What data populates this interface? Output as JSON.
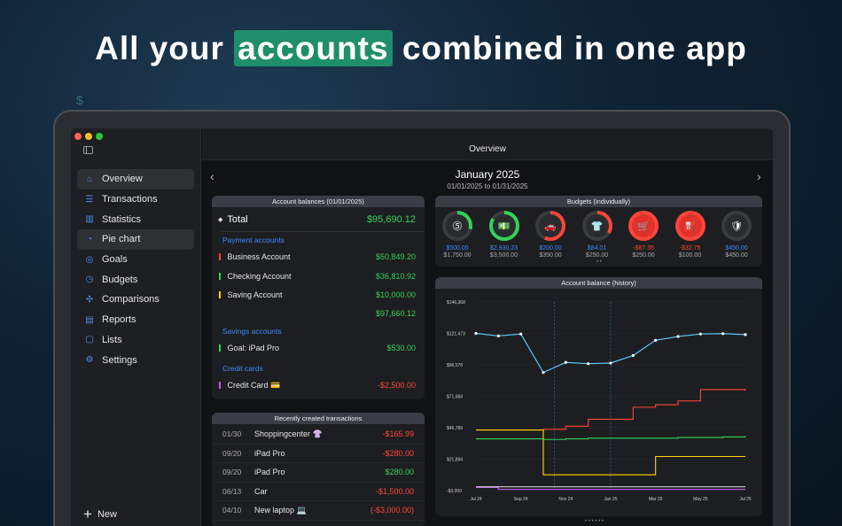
{
  "headline": {
    "pre": "All your",
    "highlight": "accounts",
    "post": "combined in one app"
  },
  "deco": "$",
  "window": {
    "title": "Overview"
  },
  "sidebar": {
    "items": [
      {
        "label": "Overview",
        "icon": "home-icon",
        "glyph": "⌂"
      },
      {
        "label": "Transactions",
        "icon": "list-icon",
        "glyph": "☰"
      },
      {
        "label": "Statistics",
        "icon": "bar-chart-icon",
        "glyph": "▥"
      },
      {
        "label": "Pie chart",
        "icon": "pie-chart-icon",
        "glyph": "◔"
      },
      {
        "label": "Goals",
        "icon": "target-icon",
        "glyph": "◎"
      },
      {
        "label": "Budgets",
        "icon": "gauge-icon",
        "glyph": "◷"
      },
      {
        "label": "Comparisons",
        "icon": "compare-icon",
        "glyph": "✣"
      },
      {
        "label": "Reports",
        "icon": "report-icon",
        "glyph": "▤"
      },
      {
        "label": "Lists",
        "icon": "document-icon",
        "glyph": "▢"
      },
      {
        "label": "Settings",
        "icon": "gear-icon",
        "glyph": "⚙"
      }
    ],
    "new_label": "New"
  },
  "header": {
    "month": "January 2025",
    "range": "01/01/2025 to 01/31/2025"
  },
  "balances": {
    "title": "Account balances (01/01/2025)",
    "total_label": "Total",
    "total_value": "$95,690.12",
    "payment_heading": "Payment accounts",
    "payment": [
      {
        "name": "Business Account",
        "value": "$50,849.20",
        "color": "#ff453a"
      },
      {
        "name": "Checking Account",
        "value": "$36,810.92",
        "color": "#33d35a"
      },
      {
        "name": "Saving Account",
        "value": "$10,000.00",
        "color": "#ffd60a"
      }
    ],
    "payment_subtotal": "$97,660.12",
    "savings_heading": "Savings accounts",
    "savings": [
      {
        "name": "Goal: iPad Pro",
        "value": "$530.00",
        "color": "#33d35a"
      }
    ],
    "credit_heading": "Credit cards",
    "credit": [
      {
        "name": "Credit Card 💳",
        "value": "-$2,500.00",
        "color": "#bf5af2"
      }
    ]
  },
  "transactions": {
    "title": "Recently created transactions",
    "rows": [
      {
        "date": "01/30",
        "name": "Shoppingcenter 👚",
        "amount": "-$165.99",
        "neg": true
      },
      {
        "date": "09/20",
        "name": "iPad Pro",
        "amount": "-$280.00",
        "neg": true
      },
      {
        "date": "09/20",
        "name": "iPad Pro",
        "amount": "$280.00",
        "neg": false
      },
      {
        "date": "06/13",
        "name": "Car",
        "amount": "-$1,500.00",
        "neg": true
      },
      {
        "date": "04/10",
        "name": "New laptop 💻",
        "amount": "(-$3,000.00)",
        "neg": true
      }
    ]
  },
  "budgets": {
    "title": "Budgets (individually)",
    "items": [
      {
        "icon": "coins-icon",
        "glyph": "⓹",
        "value": "$500.00",
        "max": "$1,750.00",
        "progress": 0.29,
        "color": "#33d35a",
        "neg": false
      },
      {
        "icon": "banknote-icon",
        "glyph": "💵",
        "value": "$2,930.23",
        "max": "$3,500.00",
        "progress": 0.84,
        "color": "#33d35a",
        "neg": false
      },
      {
        "icon": "car-icon",
        "glyph": "🚗",
        "value": "$200.00",
        "max": "$350.00",
        "progress": 0.57,
        "color": "#ff453a",
        "neg": false
      },
      {
        "icon": "shirt-icon",
        "glyph": "👕",
        "value": "$84.01",
        "max": "$250.00",
        "progress": 0.34,
        "color": "#ff453a",
        "neg": false
      },
      {
        "icon": "cart-icon",
        "glyph": "🛒",
        "value": "-$87.35",
        "max": "$250.00",
        "progress": 1,
        "color": "#ff453a",
        "neg": true
      },
      {
        "icon": "fuel-icon",
        "glyph": "⛽",
        "value": "-$32.75",
        "max": "$100.00",
        "progress": 1,
        "color": "#ff453a",
        "neg": true
      },
      {
        "icon": "shield-icon",
        "glyph": "🛡",
        "value": "$450.00",
        "max": "$450.00",
        "progress": 0,
        "color": "#ff453a",
        "neg": false
      }
    ]
  },
  "chart_data": {
    "type": "line",
    "title": "Account balance (history)",
    "x": [
      "Jul 24",
      "Aug 24",
      "Sep 24",
      "Oct 24",
      "Nov 24",
      "Dec 24",
      "Jan 25",
      "Feb 25",
      "Mar 25",
      "Apr 25",
      "May 25",
      "Jun 25",
      "Jul 25"
    ],
    "x_ticks": [
      "Jul 24",
      "Sep 24",
      "Nov 24",
      "Jan 25",
      "Mar 25",
      "May 25",
      "Jul 25"
    ],
    "y_ticks": [
      "$146,368",
      "$121,473",
      "$96,578",
      "$71,684",
      "$46,789",
      "$21,894",
      "-$3,000"
    ],
    "ylim": [
      -3000,
      146368
    ],
    "series": [
      {
        "color": "#5ac8fa",
        "values": [
          121473,
          119500,
          121000,
          90500,
          98500,
          97500,
          98000,
          104000,
          116000,
          119000,
          121000,
          121300,
          120500
        ]
      },
      {
        "color": "#ff453a",
        "values": [
          45000,
          45000,
          45000,
          45500,
          48000,
          53500,
          53500,
          63000,
          65000,
          68000,
          77000,
          77000,
          76000
        ]
      },
      {
        "color": "#33d35a",
        "values": [
          38000,
          38000,
          38000,
          37500,
          38000,
          38500,
          38500,
          38500,
          38500,
          39000,
          39000,
          39500,
          40000
        ]
      },
      {
        "color": "#ffd60a",
        "values": [
          45000,
          45000,
          45000,
          9500,
          9500,
          9500,
          9500,
          9500,
          24000,
          24000,
          24000,
          24000,
          24000
        ]
      },
      {
        "color": "#bf5af2",
        "values": [
          -500,
          -2000,
          -2000,
          -2000,
          -2000,
          -2000,
          -2000,
          -2000,
          -2000,
          -2000,
          -2000,
          -2000,
          -2000
        ]
      },
      {
        "color": "#cfcfcf",
        "values": [
          0,
          0,
          0,
          0,
          0,
          0,
          0,
          0,
          0,
          0,
          0,
          0,
          0
        ]
      }
    ]
  }
}
